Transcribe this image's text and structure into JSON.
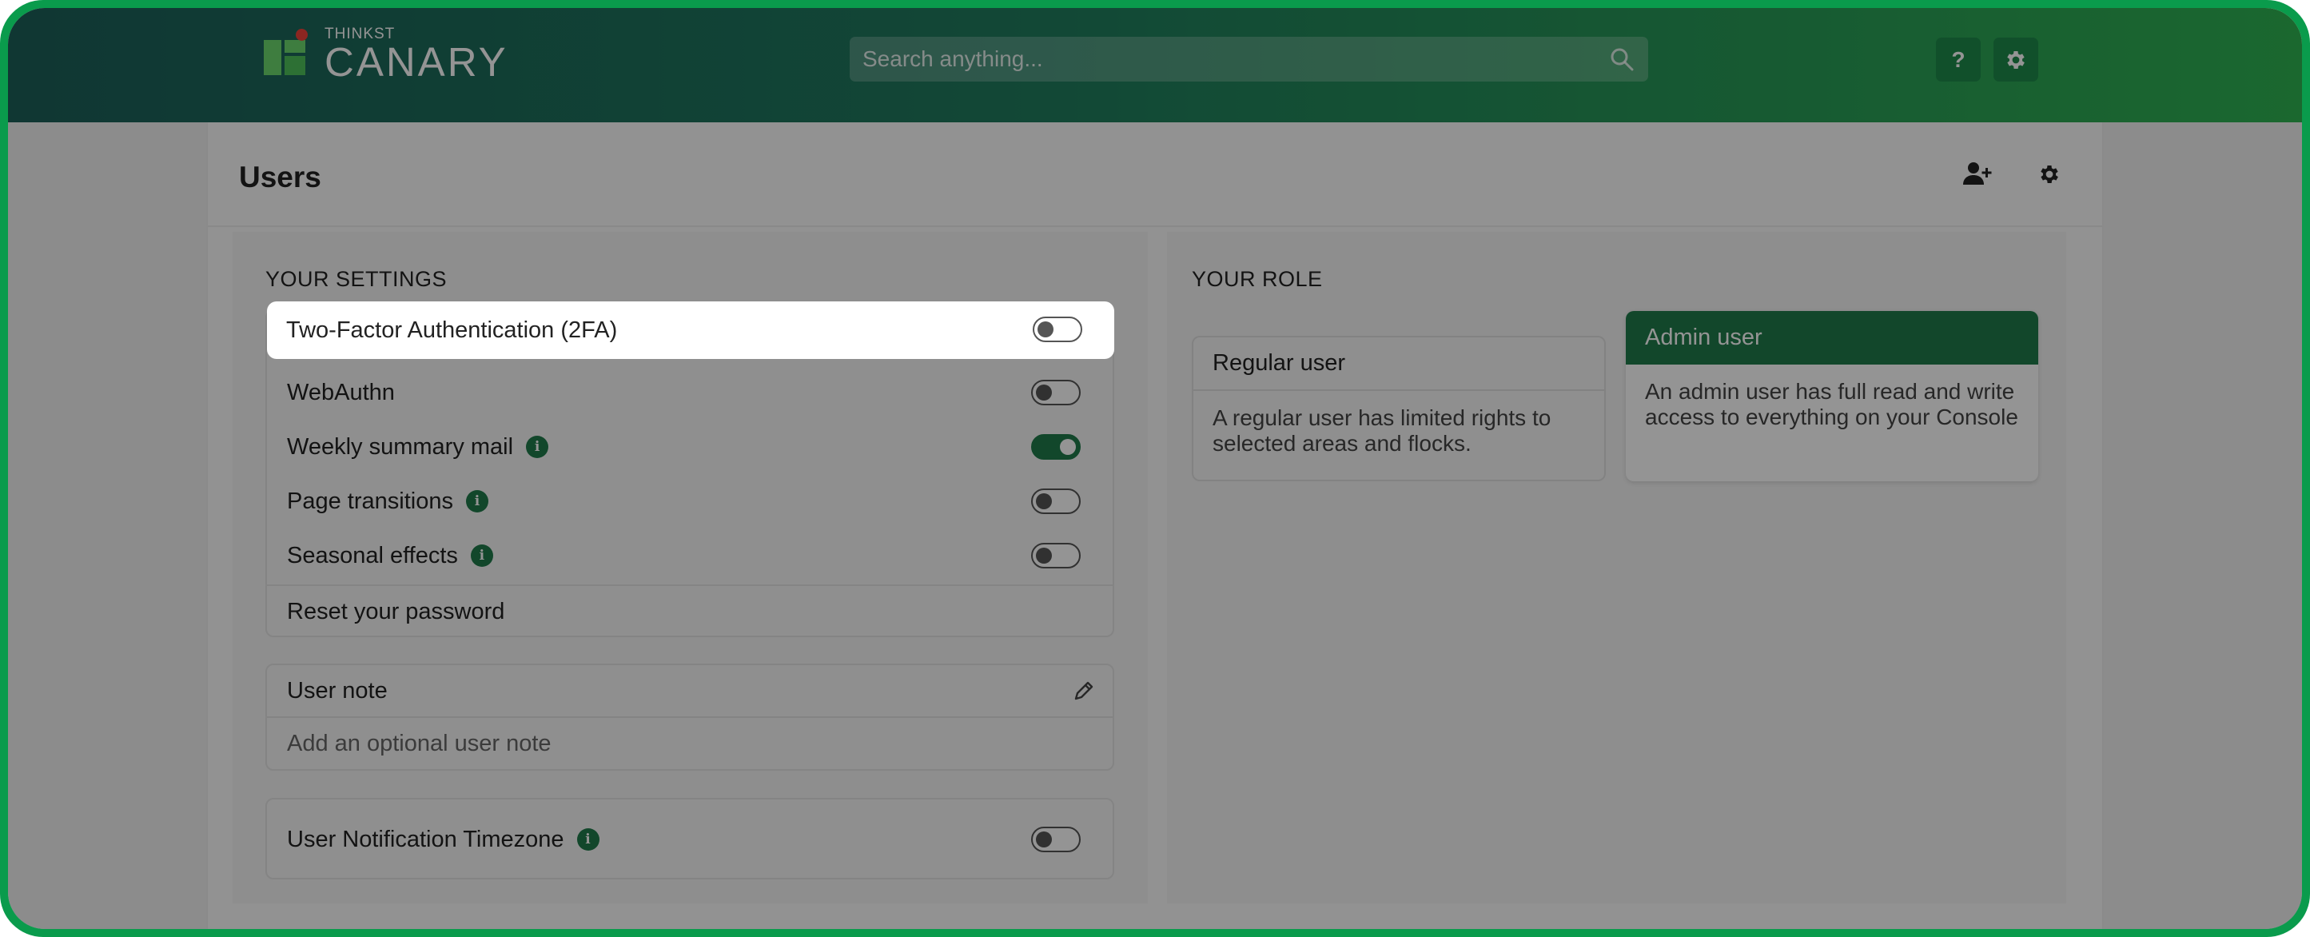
{
  "header": {
    "logo_small": "THINKST",
    "logo_big": "CANARY",
    "search_placeholder": "Search anything...",
    "help_label": "?"
  },
  "page": {
    "title": "Users"
  },
  "settings": {
    "section_label": "YOUR SETTINGS",
    "rows": [
      {
        "label": "Two-Factor Authentication (2FA)",
        "enabled": false,
        "info": false
      },
      {
        "label": "WebAuthn",
        "enabled": false,
        "info": false
      },
      {
        "label": "Weekly summary mail",
        "enabled": true,
        "info": true
      },
      {
        "label": "Page transitions",
        "enabled": false,
        "info": true
      },
      {
        "label": "Seasonal effects",
        "enabled": false,
        "info": true
      }
    ],
    "reset_password": "Reset your password",
    "user_note": {
      "title": "User note",
      "placeholder": "Add an optional user note"
    },
    "timezone": {
      "label": "User Notification Timezone",
      "enabled": false
    },
    "info_glyph": "i"
  },
  "role": {
    "section_label": "YOUR ROLE",
    "cards": [
      {
        "title": "Regular user",
        "description": "A regular user has limited rights to selected areas and flocks.",
        "active": false
      },
      {
        "title": "Admin user",
        "description": "An admin user has full read and write access to everything on your Console",
        "active": true
      }
    ]
  },
  "colors": {
    "brand_green": "#1f7a4a",
    "frame_green": "#0a9b4c",
    "header_start": "#1c5f59",
    "header_end": "#2fb352"
  }
}
